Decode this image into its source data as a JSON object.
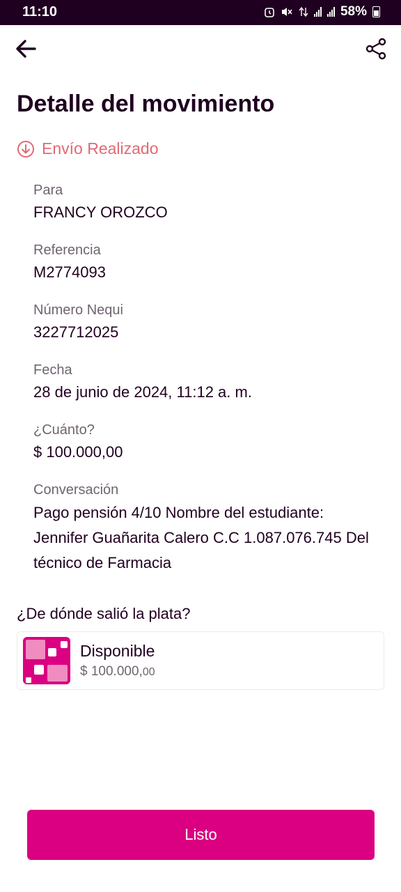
{
  "status_bar": {
    "time": "11:10",
    "battery": "58%"
  },
  "header": {
    "title": "Detalle del movimiento",
    "back_icon": "arrow-left-icon",
    "share_icon": "share-icon"
  },
  "transaction": {
    "status": "Envío Realizado",
    "status_color": "#e06a74",
    "fields": [
      {
        "label": "Para",
        "value": "FRANCY OROZCO"
      },
      {
        "label": "Referencia",
        "value": "M2774093"
      },
      {
        "label": "Número Nequi",
        "value": "3227712025"
      },
      {
        "label": "Fecha",
        "value": "28 de junio de 2024, 11:12 a. m."
      },
      {
        "label": "¿Cuánto?",
        "value": "$ 100.000,00"
      },
      {
        "label": "Conversación",
        "value": "Pago pensión 4/10 Nombre del estudiante: Jennifer Guañarita Calero C.C 1.087.076.745 Del técnico de Farmacia"
      }
    ]
  },
  "source": {
    "title": "¿De dónde salió la plata?",
    "name": "Disponible",
    "amount": "$ 100.000,",
    "amount_cents": "00"
  },
  "actions": {
    "done_label": "Listo",
    "accent_color": "#da0081"
  }
}
